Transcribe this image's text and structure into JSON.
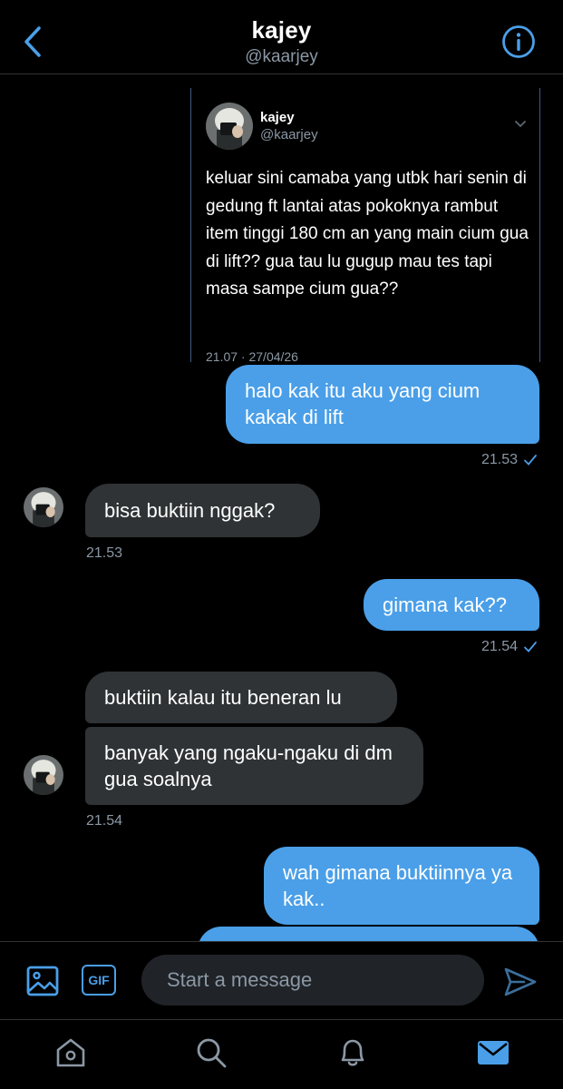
{
  "header": {
    "title": "kajey",
    "handle": "@kaarjey"
  },
  "quoted_tweet": {
    "name": "kajey",
    "handle": "@kaarjey",
    "text": "keluar sini camaba yang utbk hari senin di gedung ft lantai atas pokoknya rambut item tinggi 180 cm an yang main cium gua di lift?? gua tau lu gugup mau tes tapi masa sampe cium gua??",
    "timestamp": "21.07 · 27/04/26"
  },
  "messages": [
    {
      "direction": "sent",
      "text": "halo kak itu aku yang cium kakak di lift",
      "time": "21.53"
    },
    {
      "direction": "received",
      "text": "bisa buktiin nggak?",
      "time": "21.53"
    },
    {
      "direction": "sent",
      "text": "gimana kak??",
      "time": "21.54"
    },
    {
      "direction": "received",
      "text": "buktiin kalau itu beneran lu"
    },
    {
      "direction": "received",
      "text": "banyak yang ngaku-ngaku di dm gua soalnya",
      "time": "21.54"
    },
    {
      "direction": "sent",
      "text": "wah gimana buktiinnya ya kak.."
    }
  ],
  "composer": {
    "placeholder": "Start a message",
    "gif_label": "GIF"
  },
  "tabs": [
    "home",
    "search",
    "notifications",
    "messages"
  ],
  "active_tab": "messages",
  "colors": {
    "accent": "#4a9fe8",
    "background": "#000000",
    "received_bubble": "#2f3336",
    "muted_text": "#8b98a5"
  }
}
